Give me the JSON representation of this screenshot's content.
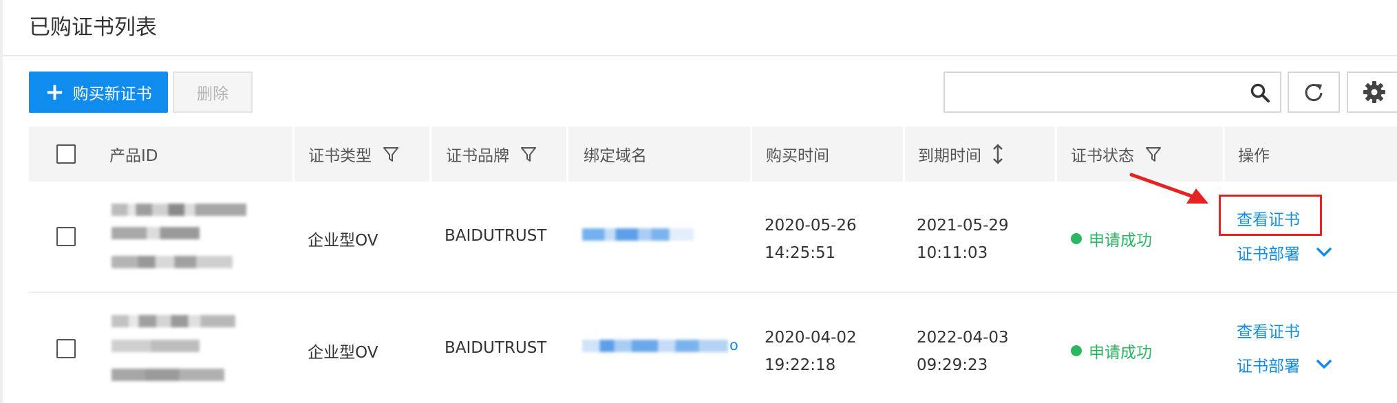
{
  "page": {
    "title": "已购证书列表"
  },
  "toolbar": {
    "buy_label": "购买新证书",
    "delete_label": "删除",
    "search": {
      "value": "",
      "placeholder": ""
    }
  },
  "columns": {
    "product_id": "产品ID",
    "cert_type": "证书类型",
    "cert_brand": "证书品牌",
    "domain": "绑定域名",
    "purchase_time": "购买时间",
    "expire_time": "到期时间",
    "status": "证书状态",
    "actions": "操作"
  },
  "rows": [
    {
      "product_id": "",
      "cert_type": "企业型OV",
      "cert_brand": "BAIDUTRUST",
      "domain": "",
      "purchase_date": "2020-05-26",
      "purchase_clock": "14:25:51",
      "expire_date": "2021-05-29",
      "expire_clock": "10:11:03",
      "status": "申请成功",
      "view_label": "查看证书",
      "deploy_label": "证书部署"
    },
    {
      "product_id": "",
      "cert_type": "企业型OV",
      "cert_brand": "BAIDUTRUST",
      "domain": "",
      "domain_fragment": "o",
      "purchase_date": "2020-04-02",
      "purchase_clock": "19:22:18",
      "expire_date": "2022-04-03",
      "expire_clock": "09:29:23",
      "status": "申请成功",
      "view_label": "查看证书",
      "deploy_label": "证书部署"
    }
  ],
  "colors": {
    "primary": "#108cee",
    "success": "#2cb663",
    "annotation": "#e42322"
  },
  "icons": [
    "plus-icon",
    "search-icon",
    "refresh-icon",
    "settings-icon",
    "filter-icon",
    "sort-icon",
    "chevron-down-icon",
    "arrow-annotation"
  ]
}
